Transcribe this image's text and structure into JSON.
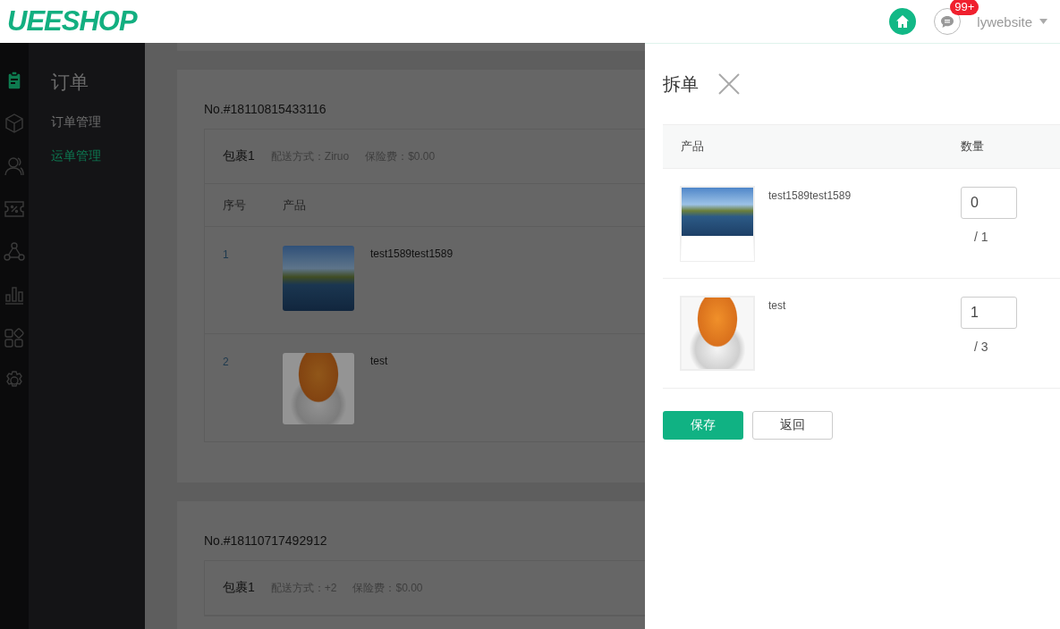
{
  "header": {
    "logo": "UEESHOP",
    "notification_badge": "99+",
    "username": "lywebsite"
  },
  "rail_items": [
    {
      "selected": true
    },
    {
      "selected": false
    },
    {
      "selected": false
    },
    {
      "selected": false
    },
    {
      "selected": false
    },
    {
      "selected": false
    },
    {
      "selected": false
    },
    {
      "selected": false
    }
  ],
  "submenu": {
    "title": "订单",
    "items": [
      {
        "label": "订单管理",
        "selected": false
      },
      {
        "label": "运单管理",
        "selected": true
      }
    ]
  },
  "orders": [
    {
      "number": "No.#18110815433116",
      "package": {
        "name": "包裹1",
        "shipping": "配送方式：Ziruo",
        "insurance": "保险费：$0.00",
        "columns": [
          "序号",
          "产品"
        ],
        "rows": [
          {
            "index": "1",
            "kind": "landscape",
            "product": "test1589test1589"
          },
          {
            "index": "2",
            "kind": "cat",
            "product": "test"
          }
        ]
      }
    },
    {
      "number": "No.#18110717492912",
      "package": {
        "name": "包裹1",
        "shipping": "配送方式：+2",
        "insurance": "保险费：$0.00"
      }
    }
  ],
  "drawer": {
    "title": "拆单",
    "columns": [
      "产品",
      "数量"
    ],
    "rows": [
      {
        "kind": "landscape",
        "product": "test1589test1589",
        "quantity": "0",
        "total": "/ 1"
      },
      {
        "kind": "cat",
        "product": "test",
        "quantity": "1",
        "total": "/ 3"
      }
    ],
    "buttons": [
      {
        "kind": "primary",
        "label": "保存"
      },
      {
        "kind": "secondary",
        "label": "返回"
      }
    ]
  }
}
